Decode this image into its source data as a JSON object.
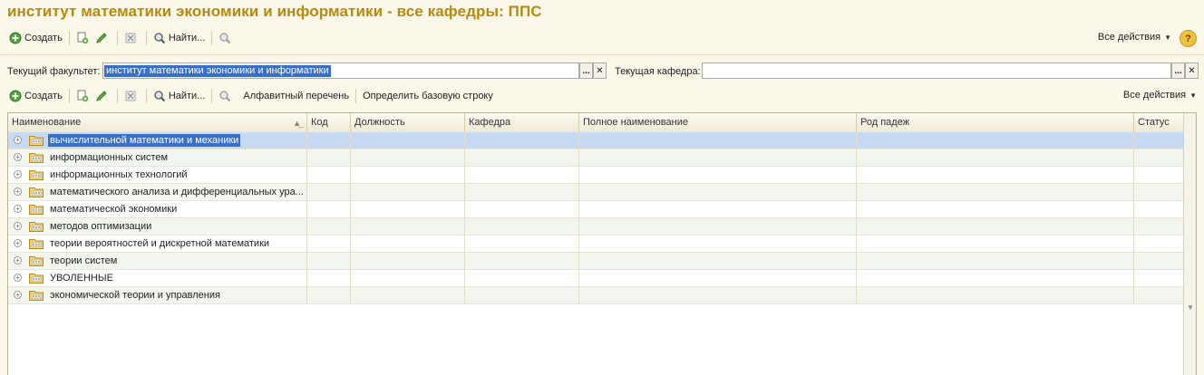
{
  "window": {
    "title": "институт математики экономики и информатики - все кафедры: ППС"
  },
  "toolbar1": {
    "create_label": "Создать",
    "find_label": "Найти...",
    "all_actions_label": "Все действия",
    "help_label": "?"
  },
  "filters": {
    "faculty_label": "Текущий факультет:",
    "faculty_value": "институт математики экономики и информатики",
    "department_label": "Текущая кафедра:",
    "department_value": "",
    "select_btn": "...",
    "clear_btn": "✕"
  },
  "toolbar2": {
    "create_label": "Создать",
    "find_label": "Найти...",
    "alphabet_label": "Алфавитный перечень",
    "baseline_label": "Определить базовую строку",
    "all_actions_label": "Все действия"
  },
  "table": {
    "columns": [
      "Наименование",
      "Код",
      "Должность",
      "Кафедра",
      "Полное наименование",
      "Род падеж",
      "Статус"
    ],
    "rows": [
      "вычислительной математики и механики",
      "информационных систем",
      "информационных технологий",
      "математического анализа и дифференциальных ура...",
      "математической экономики",
      "методов оптимизации",
      "теории вероятностей и дискретной математики",
      "теории систем",
      "УВОЛЕННЫЕ",
      "экономической теории и управления"
    ],
    "selected_row": 0
  },
  "colors": {
    "title": "#b8890c",
    "selection": "#3a6fc7",
    "background": "#fbf8ea"
  }
}
